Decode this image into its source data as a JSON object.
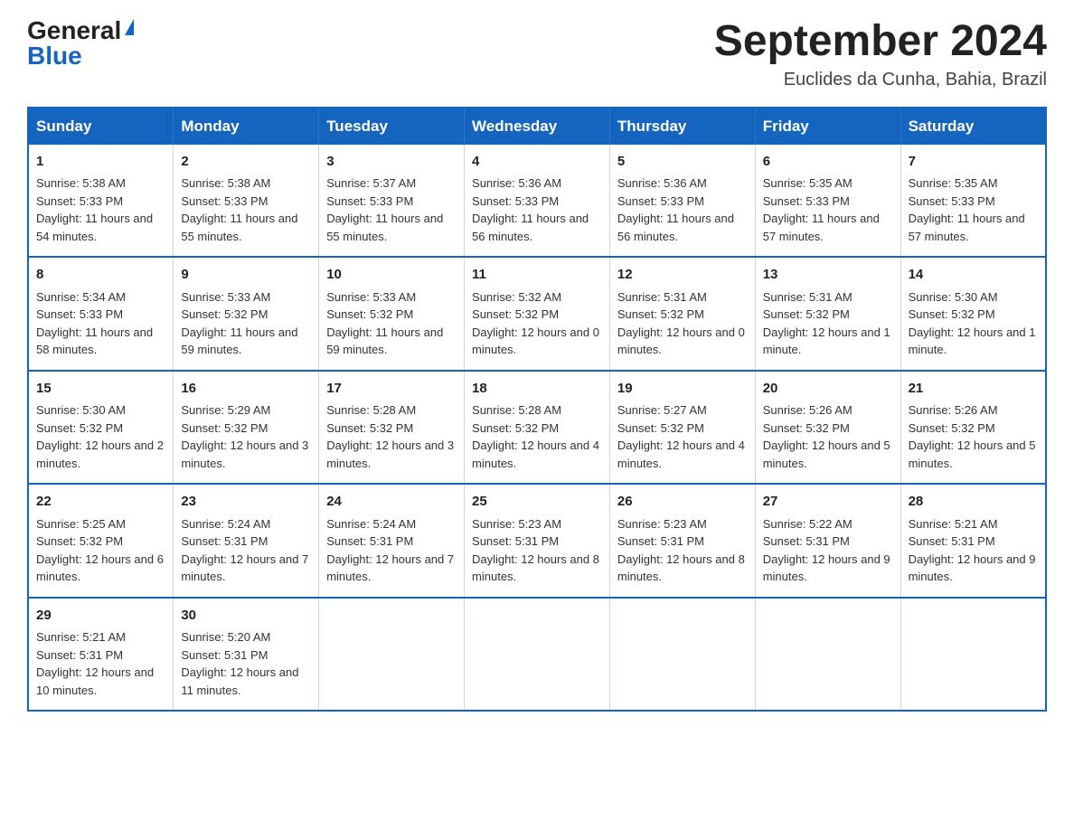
{
  "logo": {
    "general": "General",
    "blue": "Blue"
  },
  "title": {
    "month_year": "September 2024",
    "location": "Euclides da Cunha, Bahia, Brazil"
  },
  "weekdays": [
    "Sunday",
    "Monday",
    "Tuesday",
    "Wednesday",
    "Thursday",
    "Friday",
    "Saturday"
  ],
  "weeks": [
    [
      {
        "day": "1",
        "sunrise": "5:38 AM",
        "sunset": "5:33 PM",
        "daylight": "11 hours and 54 minutes."
      },
      {
        "day": "2",
        "sunrise": "5:38 AM",
        "sunset": "5:33 PM",
        "daylight": "11 hours and 55 minutes."
      },
      {
        "day": "3",
        "sunrise": "5:37 AM",
        "sunset": "5:33 PM",
        "daylight": "11 hours and 55 minutes."
      },
      {
        "day": "4",
        "sunrise": "5:36 AM",
        "sunset": "5:33 PM",
        "daylight": "11 hours and 56 minutes."
      },
      {
        "day": "5",
        "sunrise": "5:36 AM",
        "sunset": "5:33 PM",
        "daylight": "11 hours and 56 minutes."
      },
      {
        "day": "6",
        "sunrise": "5:35 AM",
        "sunset": "5:33 PM",
        "daylight": "11 hours and 57 minutes."
      },
      {
        "day": "7",
        "sunrise": "5:35 AM",
        "sunset": "5:33 PM",
        "daylight": "11 hours and 57 minutes."
      }
    ],
    [
      {
        "day": "8",
        "sunrise": "5:34 AM",
        "sunset": "5:33 PM",
        "daylight": "11 hours and 58 minutes."
      },
      {
        "day": "9",
        "sunrise": "5:33 AM",
        "sunset": "5:32 PM",
        "daylight": "11 hours and 59 minutes."
      },
      {
        "day": "10",
        "sunrise": "5:33 AM",
        "sunset": "5:32 PM",
        "daylight": "11 hours and 59 minutes."
      },
      {
        "day": "11",
        "sunrise": "5:32 AM",
        "sunset": "5:32 PM",
        "daylight": "12 hours and 0 minutes."
      },
      {
        "day": "12",
        "sunrise": "5:31 AM",
        "sunset": "5:32 PM",
        "daylight": "12 hours and 0 minutes."
      },
      {
        "day": "13",
        "sunrise": "5:31 AM",
        "sunset": "5:32 PM",
        "daylight": "12 hours and 1 minute."
      },
      {
        "day": "14",
        "sunrise": "5:30 AM",
        "sunset": "5:32 PM",
        "daylight": "12 hours and 1 minute."
      }
    ],
    [
      {
        "day": "15",
        "sunrise": "5:30 AM",
        "sunset": "5:32 PM",
        "daylight": "12 hours and 2 minutes."
      },
      {
        "day": "16",
        "sunrise": "5:29 AM",
        "sunset": "5:32 PM",
        "daylight": "12 hours and 3 minutes."
      },
      {
        "day": "17",
        "sunrise": "5:28 AM",
        "sunset": "5:32 PM",
        "daylight": "12 hours and 3 minutes."
      },
      {
        "day": "18",
        "sunrise": "5:28 AM",
        "sunset": "5:32 PM",
        "daylight": "12 hours and 4 minutes."
      },
      {
        "day": "19",
        "sunrise": "5:27 AM",
        "sunset": "5:32 PM",
        "daylight": "12 hours and 4 minutes."
      },
      {
        "day": "20",
        "sunrise": "5:26 AM",
        "sunset": "5:32 PM",
        "daylight": "12 hours and 5 minutes."
      },
      {
        "day": "21",
        "sunrise": "5:26 AM",
        "sunset": "5:32 PM",
        "daylight": "12 hours and 5 minutes."
      }
    ],
    [
      {
        "day": "22",
        "sunrise": "5:25 AM",
        "sunset": "5:32 PM",
        "daylight": "12 hours and 6 minutes."
      },
      {
        "day": "23",
        "sunrise": "5:24 AM",
        "sunset": "5:31 PM",
        "daylight": "12 hours and 7 minutes."
      },
      {
        "day": "24",
        "sunrise": "5:24 AM",
        "sunset": "5:31 PM",
        "daylight": "12 hours and 7 minutes."
      },
      {
        "day": "25",
        "sunrise": "5:23 AM",
        "sunset": "5:31 PM",
        "daylight": "12 hours and 8 minutes."
      },
      {
        "day": "26",
        "sunrise": "5:23 AM",
        "sunset": "5:31 PM",
        "daylight": "12 hours and 8 minutes."
      },
      {
        "day": "27",
        "sunrise": "5:22 AM",
        "sunset": "5:31 PM",
        "daylight": "12 hours and 9 minutes."
      },
      {
        "day": "28",
        "sunrise": "5:21 AM",
        "sunset": "5:31 PM",
        "daylight": "12 hours and 9 minutes."
      }
    ],
    [
      {
        "day": "29",
        "sunrise": "5:21 AM",
        "sunset": "5:31 PM",
        "daylight": "12 hours and 10 minutes."
      },
      {
        "day": "30",
        "sunrise": "5:20 AM",
        "sunset": "5:31 PM",
        "daylight": "12 hours and 11 minutes."
      },
      null,
      null,
      null,
      null,
      null
    ]
  ],
  "labels": {
    "sunrise": "Sunrise:",
    "sunset": "Sunset:",
    "daylight": "Daylight:"
  }
}
